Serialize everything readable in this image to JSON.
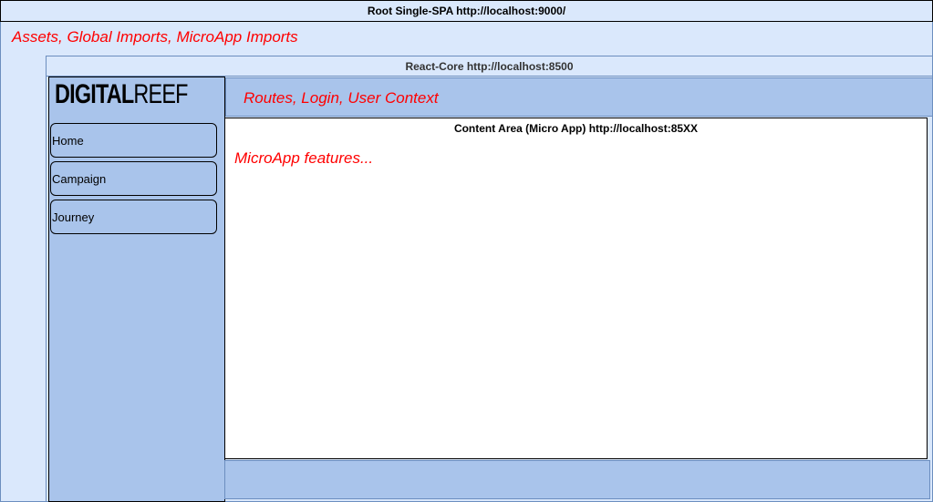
{
  "root": {
    "title": "Root Single-SPA http://localhost:9000/",
    "note": "Assets, Global Imports, MicroApp Imports"
  },
  "core": {
    "title": "React-Core http://localhost:8500",
    "note": "Routes, Login, User Context",
    "logo": {
      "bold": "DIGITAL",
      "regular": "REEF"
    },
    "nav": [
      {
        "label": "Home"
      },
      {
        "label": "Campaign"
      },
      {
        "label": "Journey"
      }
    ]
  },
  "content": {
    "title": "Content Area (Micro App) http://localhost:85XX",
    "note": "MicroApp features..."
  },
  "colors": {
    "outer_fill": "#dae8fc",
    "inner_fill": "#a9c4eb",
    "note_text": "#ff0000",
    "logo_blue": "#1a3a8c"
  }
}
